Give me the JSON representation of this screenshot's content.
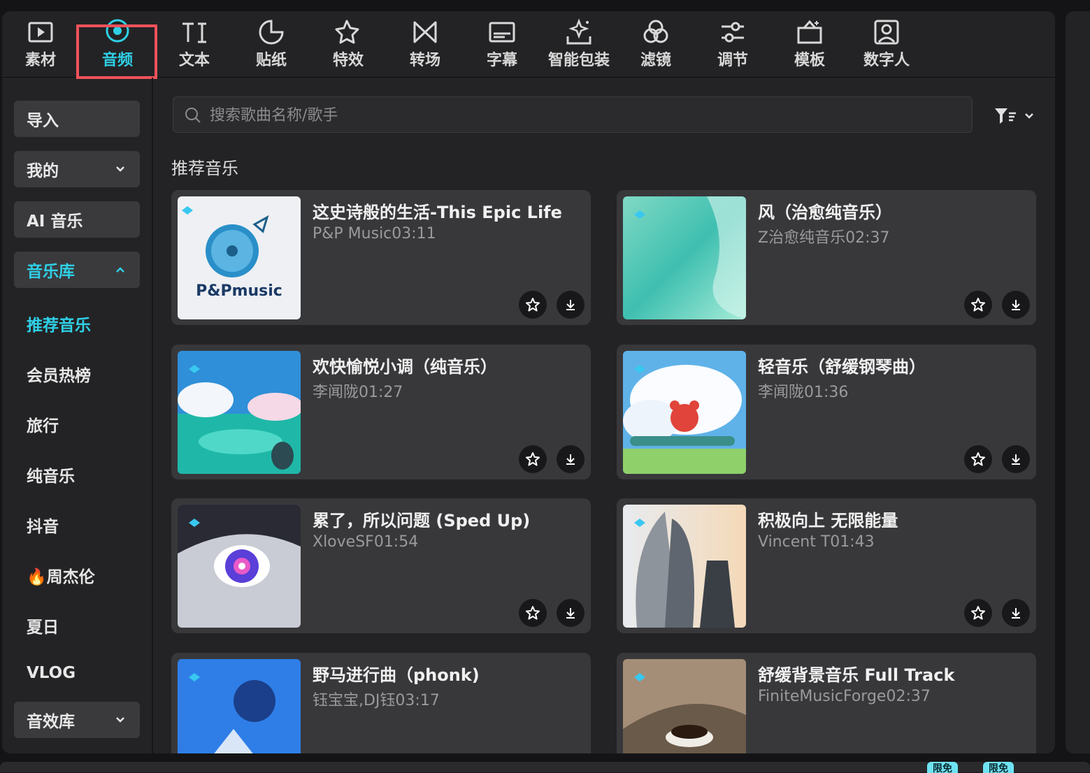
{
  "toolbar": {
    "tabs": [
      {
        "label": "素材",
        "icon": "media-icon"
      },
      {
        "label": "音频",
        "icon": "audio-icon",
        "active": true
      },
      {
        "label": "文本",
        "icon": "text-icon"
      },
      {
        "label": "贴纸",
        "icon": "sticker-icon"
      },
      {
        "label": "特效",
        "icon": "effects-icon"
      },
      {
        "label": "转场",
        "icon": "transition-icon"
      },
      {
        "label": "字幕",
        "icon": "subtitle-icon"
      },
      {
        "label": "智能包装",
        "icon": "smart-package-icon"
      },
      {
        "label": "滤镜",
        "icon": "filter-icon"
      },
      {
        "label": "调节",
        "icon": "adjust-icon"
      },
      {
        "label": "模板",
        "icon": "template-icon"
      },
      {
        "label": "数字人",
        "icon": "digital-human-icon"
      }
    ]
  },
  "sidebar": {
    "buttons": [
      {
        "label": "导入"
      },
      {
        "label": "我的"
      },
      {
        "label": "AI 音乐"
      },
      {
        "label": "音乐库"
      }
    ],
    "items": [
      {
        "label": "推荐音乐"
      },
      {
        "label": "会员热榜"
      },
      {
        "label": "旅行"
      },
      {
        "label": "纯音乐"
      },
      {
        "label": "抖音"
      },
      {
        "label": "🔥周杰伦"
      },
      {
        "label": "夏日"
      },
      {
        "label": "VLOG"
      }
    ],
    "sfx_button": {
      "label": "音效库"
    }
  },
  "search": {
    "placeholder": "搜索歌曲名称/歌手"
  },
  "section": {
    "title": "推荐音乐"
  },
  "songs": [
    {
      "title": "这史诗般的生活-This Epic Life",
      "meta": "P&P Music03:11",
      "cover_text": "P&Pmusic"
    },
    {
      "title": "风（治愈纯音乐）",
      "meta": "Z治愈纯音乐02:37"
    },
    {
      "title": "欢快愉悦小调（纯音乐）",
      "meta": "李闻陇01:27"
    },
    {
      "title": "轻音乐（舒缓钢琴曲）",
      "meta": "李闻陇01:36"
    },
    {
      "title": "累了，所以问题 (Sped Up)",
      "meta": "XloveSF01:54"
    },
    {
      "title": "积极向上 无限能量",
      "meta": "Vincent T01:43"
    },
    {
      "title": "野马进行曲（phonk)",
      "meta": "钰宝宝,DJ钰03:17"
    },
    {
      "title": "舒缓背景音乐  Full Track",
      "meta": "FiniteMusicForge02:37"
    }
  ],
  "badges": [
    "限免",
    "限免"
  ],
  "colors": {
    "accent": "#2fd0e6",
    "highlight": "#f0525a",
    "panel": "#232325",
    "card": "#38383b"
  }
}
